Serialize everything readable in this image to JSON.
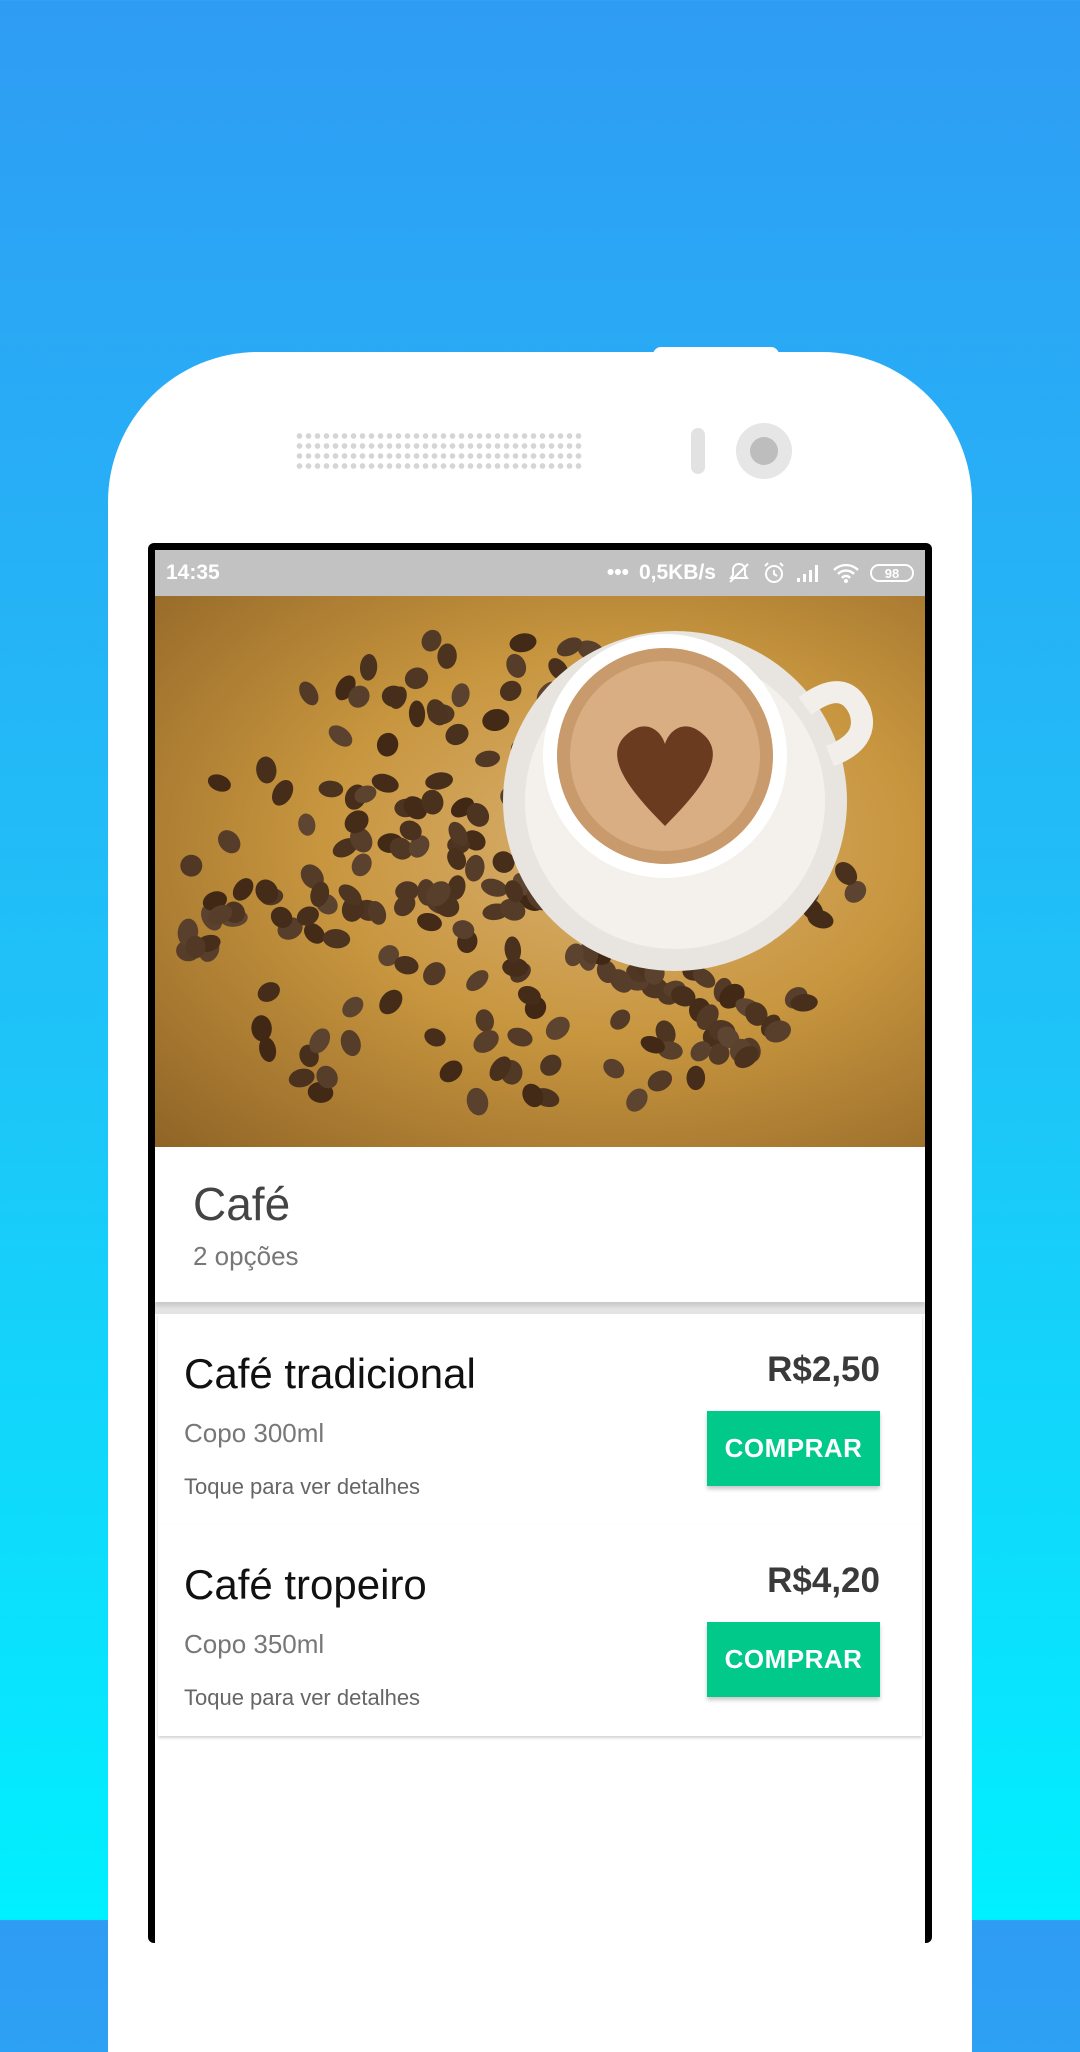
{
  "status_bar": {
    "time": "14:35",
    "dots": "•••",
    "network_speed": "0,5KB/s",
    "battery": "98",
    "icons": [
      "mute-icon",
      "alarm-icon",
      "signal-icon",
      "wifi-icon",
      "battery-icon"
    ]
  },
  "hero": {
    "image": "coffee-cup-with-heart-latte-art-and-beans"
  },
  "category": {
    "title": "Café",
    "subtitle": "2 opções"
  },
  "products": [
    {
      "name": "Café tradicional",
      "description": "Copo 300ml",
      "hint": "Toque para ver detalhes",
      "price": "R$2,50",
      "button_label": "COMPRAR"
    },
    {
      "name": "Café tropeiro",
      "description": "Copo 350ml",
      "hint": "Toque para ver detalhes",
      "price": "R$4,20",
      "button_label": "COMPRAR"
    }
  ],
  "colors": {
    "background_top": "#2f9cf4",
    "background_bottom": "#00f0ff",
    "button": "#00c98a",
    "status_bar": "#c2c2c2"
  }
}
